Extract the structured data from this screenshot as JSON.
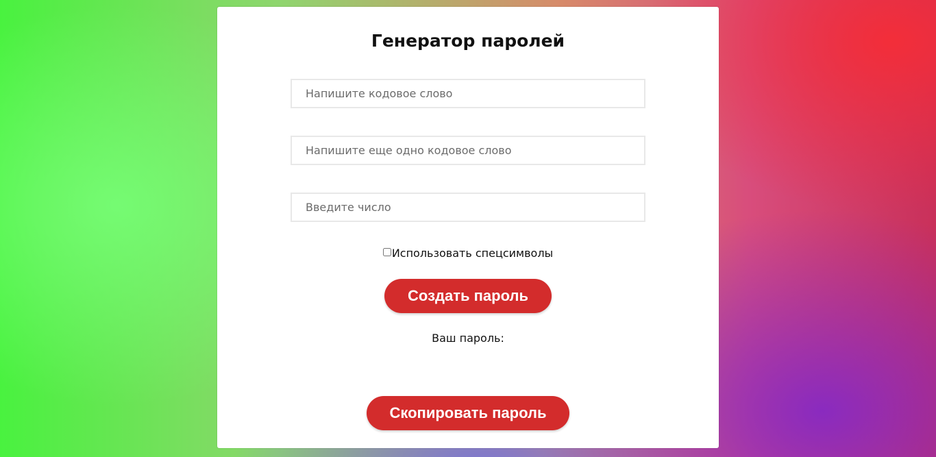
{
  "app": {
    "title": "Генератор паролей"
  },
  "form": {
    "codeword_placeholder": "Напишите кодовое слово",
    "codeword_value": "",
    "codeword2_placeholder": "Напишите еще одно кодовое слово",
    "codeword2_value": "",
    "number_placeholder": "Введите число",
    "number_value": "",
    "special_chars_label": "Использовать спецсимволы",
    "special_chars_checked": false,
    "create_button_label": "Создать пароль"
  },
  "result": {
    "label": "Ваш пароль:",
    "password": "",
    "copy_button_label": "Скопировать пароль"
  },
  "colors": {
    "accent": "#d32c2c",
    "card": "#ffffff"
  }
}
